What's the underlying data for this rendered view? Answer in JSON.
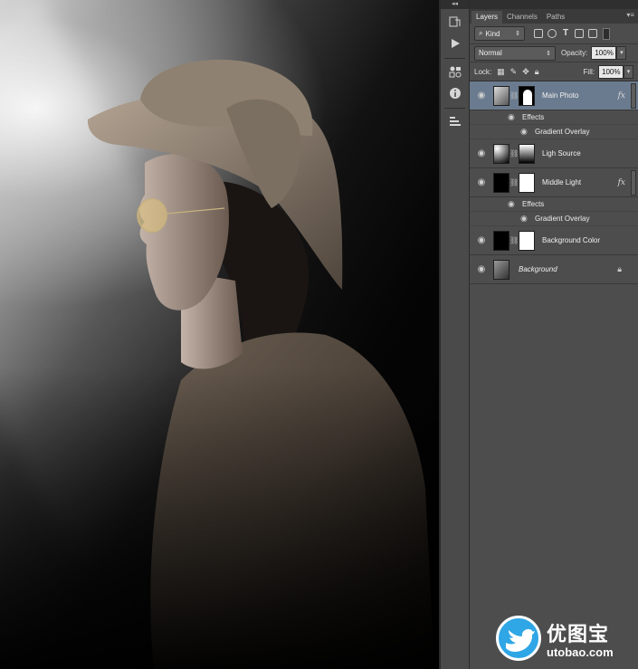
{
  "panel": {
    "tabs": [
      {
        "label": "Layers",
        "active": true
      },
      {
        "label": "Channels",
        "active": false
      },
      {
        "label": "Paths",
        "active": false
      }
    ],
    "filter": {
      "kind_label": "Kind"
    },
    "blend": {
      "mode": "Normal",
      "opacity_label": "Opacity:",
      "opacity_value": "100%"
    },
    "lock": {
      "label": "Lock:",
      "fill_label": "Fill:",
      "fill_value": "100%"
    },
    "layers": [
      {
        "name": "Main Photo",
        "selected": true,
        "fx": "fx",
        "effects_label": "Effects",
        "effect": "Gradient Overlay"
      },
      {
        "name": "Ligh Source",
        "selected": false
      },
      {
        "name": "Middle Light",
        "selected": false,
        "fx": "fx",
        "effects_label": "Effects",
        "effect": "Gradient Overlay"
      },
      {
        "name": "Background Color",
        "selected": false
      },
      {
        "name": "Background",
        "selected": false,
        "locked": true
      }
    ]
  },
  "watermark": {
    "chinese": "优图宝",
    "url": "utobao.com"
  },
  "colors": {
    "panel_bg": "#4d4d4d",
    "selected_layer": "#6b7b8f",
    "brand_blue": "#2fa6e6"
  },
  "icons": [
    "history-icon",
    "play-icon",
    "adjust-icon",
    "info-icon",
    "properties-icon",
    "eye-icon",
    "chain-icon",
    "lock-icon"
  ]
}
